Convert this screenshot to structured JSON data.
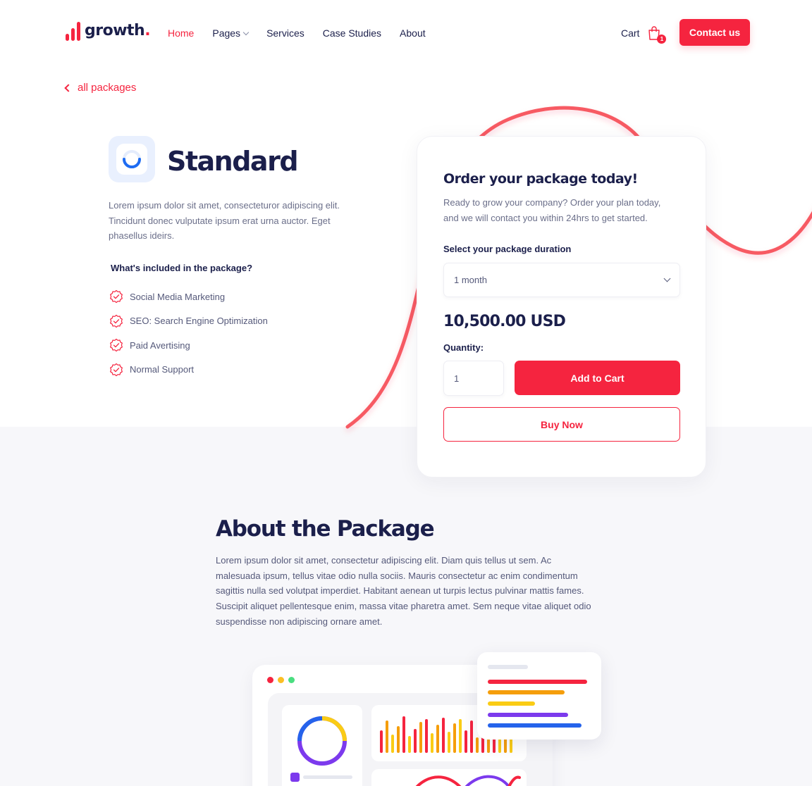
{
  "brand": {
    "name": "growth",
    "dot": ".",
    "accent": "#f5243f",
    "navy": "#1b1f4b"
  },
  "nav": {
    "home": "Home",
    "pages": "Pages",
    "services": "Services",
    "case_studies": "Case Studies",
    "about": "About"
  },
  "header": {
    "cart_label": "Cart",
    "cart_count": "1",
    "contact_label": "Contact us"
  },
  "back_link": "all packages",
  "product": {
    "title": "Standard",
    "description": "Lorem ipsum dolor sit amet, consecteturor adipiscing elit. Tincidunt donec vulputate ipsum erat urna auctor. Eget phasellus ideirs.",
    "included_title": "What's included in the package?",
    "features": [
      "Social Media Marketing",
      "SEO: Search Engine Optimization",
      "Paid Avertising",
      "Normal Support"
    ]
  },
  "order": {
    "title": "Order your package today!",
    "subtitle": "Ready to grow your company? Order your plan today, and we will contact you within 24hrs to get started.",
    "duration_label": "Select your package duration",
    "duration_value": "1 month",
    "price": "10,500.00 USD",
    "quantity_label": "Quantity:",
    "quantity_value": "1",
    "add_to_cart": "Add to Cart",
    "buy_now": "Buy Now"
  },
  "about": {
    "title": "About the Package",
    "text": "Lorem ipsum dolor sit amet, consectetur adipiscing elit. Diam quis tellus ut sem. Ac malesuada ipsum, tellus vitae odio nulla sociis. Mauris consectetur ac enim condimentum sagittis nulla sed volutpat imperdiet. Habitant aenean ut turpis lectus pulvinar mattis fames. Suscipit aliquet pellentesque enim, massa vitae pharetra amet. Sem neque vitae aliquet odio suspendisse non adipiscing ornare amet."
  },
  "illustration": {
    "window_dot_colors": [
      "#f5243f",
      "#fbbf24",
      "#4ade80"
    ],
    "float_line_colors": [
      "#e5e7ef",
      "#f5243f",
      "#f59e0b",
      "#facc15",
      "#7c3aed",
      "#2563eb"
    ],
    "bar_colors": [
      "#f5243f",
      "#f59e0b",
      "#facc15"
    ]
  }
}
